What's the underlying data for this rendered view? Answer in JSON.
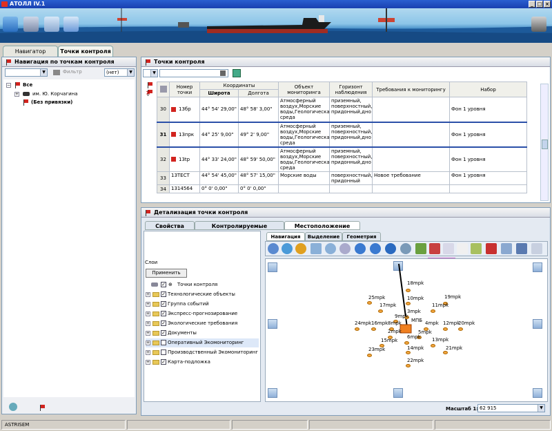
{
  "app": {
    "title": "АТОЛЛ IV.1",
    "status_left": "ASTRISEM"
  },
  "left_tabs": [
    "Навигатор",
    "Точки контроля"
  ],
  "left_panel": {
    "header": "Навигация по точкам контроля",
    "filter_label": "Фильтр",
    "filter_value": "(нет)",
    "tree": [
      {
        "label": "Все"
      },
      {
        "label": "им. Ю. Корчагина"
      },
      {
        "label": "(Без привязки)"
      }
    ]
  },
  "main_panel": {
    "header": "Точки контроля",
    "columns": {
      "num": "Номер точки",
      "coords": "Координаты",
      "lat": "Широта",
      "lon": "Долгота",
      "object": "Объект мониторинга",
      "horizon": "Горизонт наблюдения",
      "req": "Требования к мониторингу",
      "set": "Набор"
    },
    "rows": [
      {
        "row": "30",
        "num": "13бр",
        "lat": "44° 54' 29,00\"",
        "lon": "48° 58' 3,00\"",
        "object": "Атмосферный воздух,Морские воды,Геологическая среда",
        "horizon": "приземный, поверхностный, придонный,дно",
        "req": "",
        "set": "Фон 1 уровня"
      },
      {
        "row": "31",
        "num": "13прк",
        "lat": "44° 25' 9,00\"",
        "lon": "49° 2' 9,00\"",
        "object": "Атмосферный воздух,Морские воды,Геологическая среда",
        "horizon": "приземный, поверхностный, придонный,дно",
        "req": "",
        "set": "Фон 1 уровня"
      },
      {
        "row": "32",
        "num": "13tp",
        "lat": "44° 33' 24,00\"",
        "lon": "48° 59' 50,00\"",
        "object": "Атмосферный воздух,Морские воды,Геологическая среда",
        "horizon": "приземный, поверхностный, придонный,дно",
        "req": "",
        "set": "Фон 1 уровня"
      },
      {
        "row": "33",
        "num": "13ТЕСТ",
        "lat": "44° 54' 45,00\"",
        "lon": "48° 57' 15,00\"",
        "object": "Морские воды",
        "horizon": "поверхностный, придонный",
        "req": "Новое требование",
        "set": "Фон 1 уровня"
      },
      {
        "row": "34",
        "num": "1314564",
        "lat": "0° 0' 0,00\"",
        "lon": "0° 0' 0,00\"",
        "object": "",
        "horizon": "",
        "req": "",
        "set": ""
      }
    ]
  },
  "detail": {
    "header": "Детализация точки контроля",
    "tabs": [
      "Свойства",
      "Контролируемые параметры",
      "Местоположение"
    ],
    "subtabs": [
      "Навигация",
      "Выделение",
      "Геометрия"
    ],
    "layers_title": "Слои",
    "apply_label": "Применить",
    "layers": [
      {
        "label": "Точки контроля",
        "checked": true
      },
      {
        "label": "Технологические объекты",
        "checked": true
      },
      {
        "label": "Группа событий",
        "checked": true
      },
      {
        "label": "Экспресс-прогнозирование",
        "checked": true
      },
      {
        "label": "Экологические требования",
        "checked": true
      },
      {
        "label": "Документы",
        "checked": true
      },
      {
        "label": "Оперативный Экомониторинг",
        "checked": false
      },
      {
        "label": "Производственный Экомониторинг",
        "checked": false
      },
      {
        "label": "Карта-подложка",
        "checked": true
      }
    ],
    "map_labels": [
      "18mpk",
      "10mpk",
      "19mpk",
      "25mpk",
      "17mpk",
      "11mpk",
      "3mpk",
      "9mpk",
      "24mpk",
      "16mpk",
      "8mpk",
      "МПБ",
      "4mpk",
      "12mpk",
      "20mpk",
      "2mpk",
      "5mpk",
      "6mpk",
      "15mpk",
      "13mpk",
      "23mpk",
      "14mpk",
      "21mpk",
      "22mpk"
    ],
    "scale_label": "Масштаб 1:",
    "scale_value": "62 915"
  }
}
